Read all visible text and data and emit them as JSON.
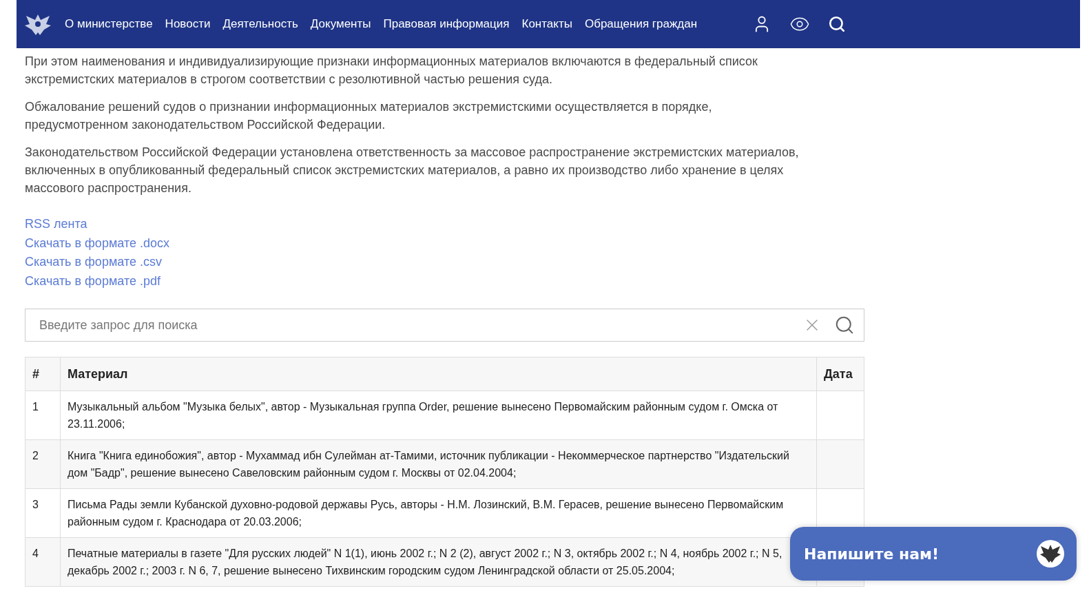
{
  "header": {
    "nav": [
      {
        "label": "О министерстве"
      },
      {
        "label": "Новости"
      },
      {
        "label": "Деятельность"
      },
      {
        "label": "Документы"
      },
      {
        "label": "Правовая информация"
      },
      {
        "label": "Контакты"
      },
      {
        "label": "Обращения граждан"
      }
    ]
  },
  "paragraphs": [
    "При этом наименования и индивидуализирующие признаки информационных материалов включаются в федеральный список экстремистских материалов в строгом соответствии с резолютивной частью решения суда.",
    "Обжалование решений судов о признании информационных материалов экстремистскими осуществляется в порядке, предусмотренном законодательством Российской Федерации.",
    "Законодательством Российской Федерации установлена ответственность за массовое распространение экстремистских материалов, включенных в опубликованный федеральный список экстремистских материалов, а равно их производство либо хранение в целях массового распространения."
  ],
  "links": [
    "RSS лента",
    "Скачать в формате .docx",
    "Скачать в формате .csv",
    "Скачать в формате .pdf"
  ],
  "search": {
    "placeholder": "Введите запрос для поиска"
  },
  "table": {
    "columns": [
      "#",
      "Материал",
      "Дата"
    ],
    "rows": [
      {
        "num": "1",
        "material": "Музыкальный альбом \"Музыка белых\", автор - Музыкальная группа Order, решение вынесено Первомайским районным судом г. Омска от 23.11.2006;"
      },
      {
        "num": "2",
        "material": "Книга \"Книга единобожия\", автор - Мухаммад ибн Сулейман ат-Тамими, источник публикации - Некоммерческое партнерство \"Издательский дом \"Бадр\", решение вынесено Савеловским районным судом г. Москвы от 02.04.2004;"
      },
      {
        "num": "3",
        "material": "Письма Рады земли Кубанской духовно-родовой державы Русь, авторы - Н.М. Лозинский, В.М. Герасев, решение вынесено Первомайским районным судом г. Краснодара от 20.03.2006;"
      },
      {
        "num": "4",
        "material": "Печатные материалы в газете \"Для русских людей\" N 1(1), июнь 2002 г.; N 2 (2), август 2002 г.; N 3, октябрь 2002 г.; N 4, ноябрь 2002 г.; N 5, декабрь 2002 г.; 2003 г. N 6, 7, решение вынесено Тихвинским городским судом Ленинградской области от 25.05.2004;"
      }
    ]
  },
  "chat_widget": {
    "label": "Напишите нам!"
  }
}
